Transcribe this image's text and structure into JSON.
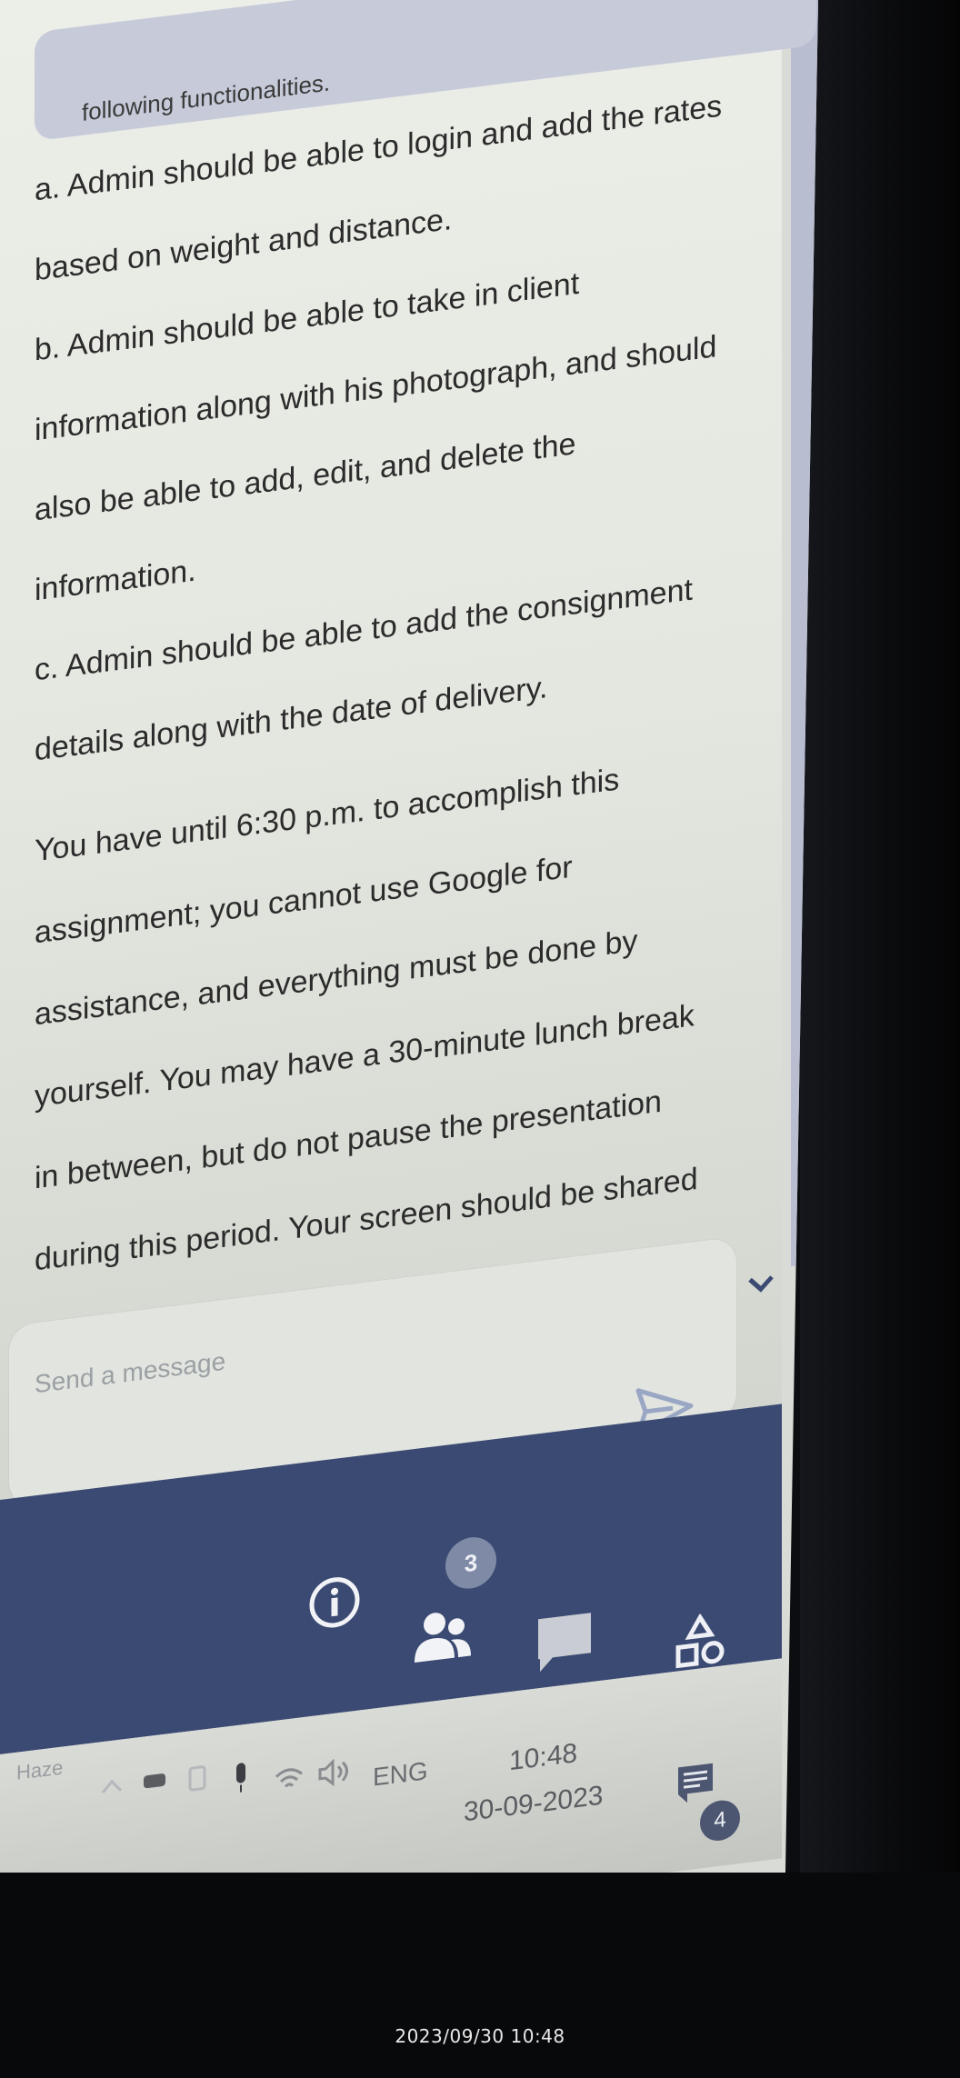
{
  "chat": {
    "truncated_line": "following functionalities.",
    "requirements": [
      "a. Admin should be able to login and add the rates based on weight and distance.",
      "b. Admin should be able to take in client information along with his photograph, and should also be able to add, edit, and delete the information.",
      "c. Admin should be able to add the consignment details along with the date of delivery."
    ],
    "instructions": "You have until 6:30 p.m. to accomplish this assignment; you cannot use Google for assistance, and everything must be done by yourself. You may have a 30-minute lunch break in between, but do not pause the presentation during this period. Your screen should be shared at all times during this interview, and the camera should be turned on. You have the option of muting the microphone. Please copy  this question.",
    "input": {
      "placeholder": "Send a message"
    }
  },
  "call_bar": {
    "participants_count": "3",
    "icons": [
      "info-icon",
      "people-icon",
      "chat-icon",
      "activities-icon"
    ],
    "accent_color": "#3b4a72"
  },
  "taskbar": {
    "weather": "Haze",
    "language": "ENG",
    "time": "10:48",
    "date": "30-09-2023",
    "notification_count": "4"
  },
  "photo_timestamp": "2023/09/30 10:48"
}
